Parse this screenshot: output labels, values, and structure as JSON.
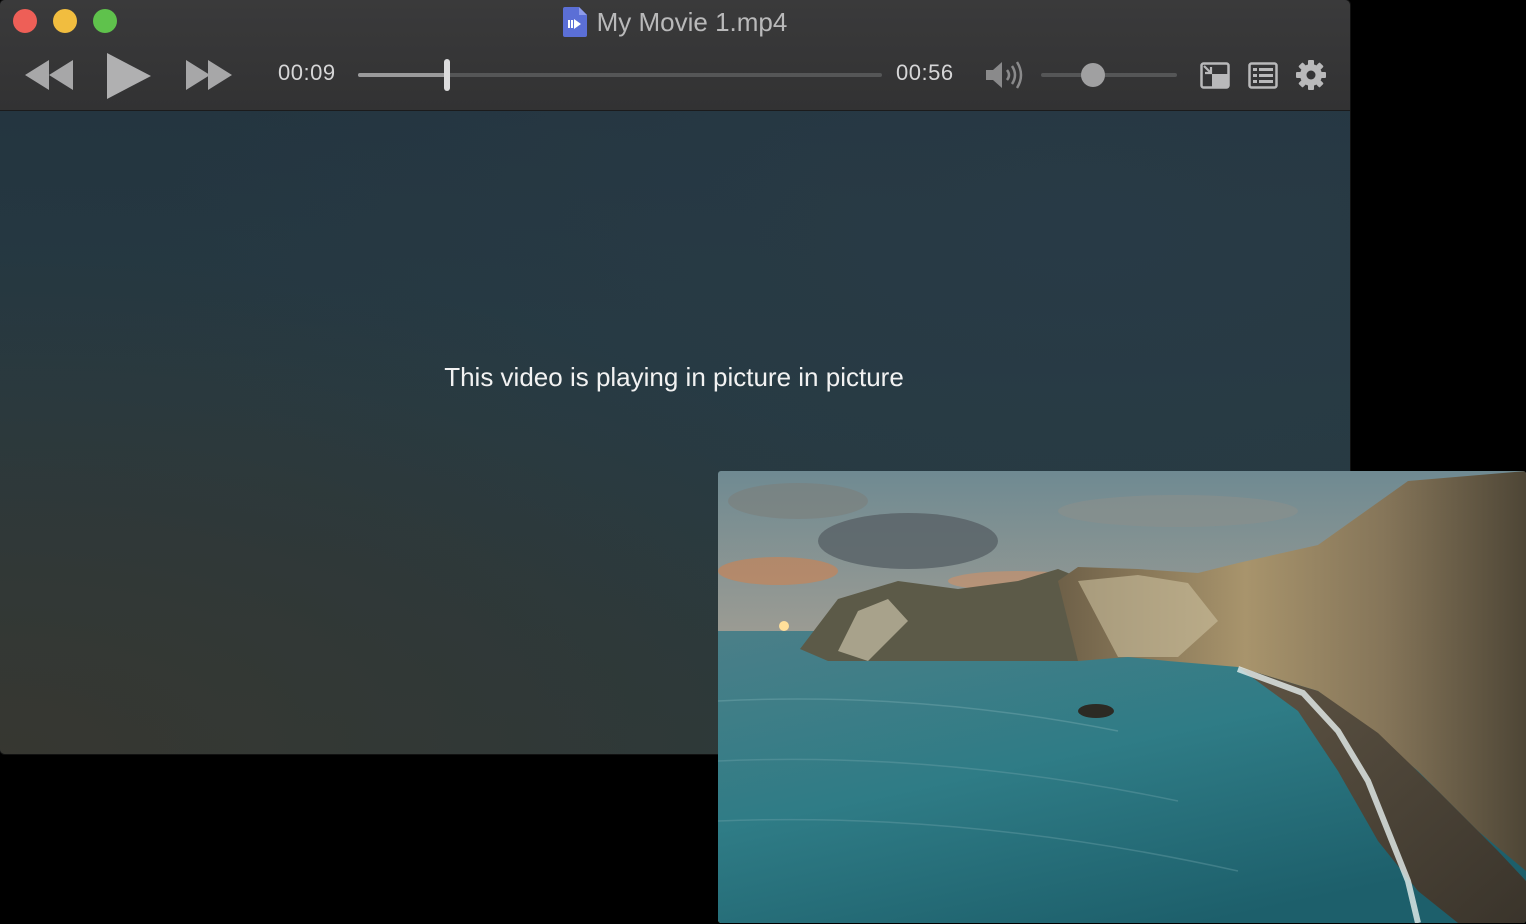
{
  "window": {
    "title": "My Movie 1.mp4"
  },
  "player": {
    "elapsed": "00:09",
    "duration": "00:56",
    "playback_progress": 0.17,
    "volume_level": 0.38
  },
  "content": {
    "pip_message": "This video is playing in picture in picture"
  },
  "icons": {
    "close": "close-icon",
    "minimize": "minimize-icon",
    "zoom": "zoom-icon",
    "file": "video-file-icon",
    "rewind": "rewind-icon",
    "play": "play-icon",
    "fast_forward": "fast-forward-icon",
    "volume": "volume-icon",
    "pip": "picture-in-picture-icon",
    "playlist": "playlist-icon",
    "settings": "gear-icon"
  },
  "colors": {
    "close": "#ee5f57",
    "minimize": "#f1bd3f",
    "zoom": "#5fc24c",
    "file_icon": "#5b6fd6"
  }
}
